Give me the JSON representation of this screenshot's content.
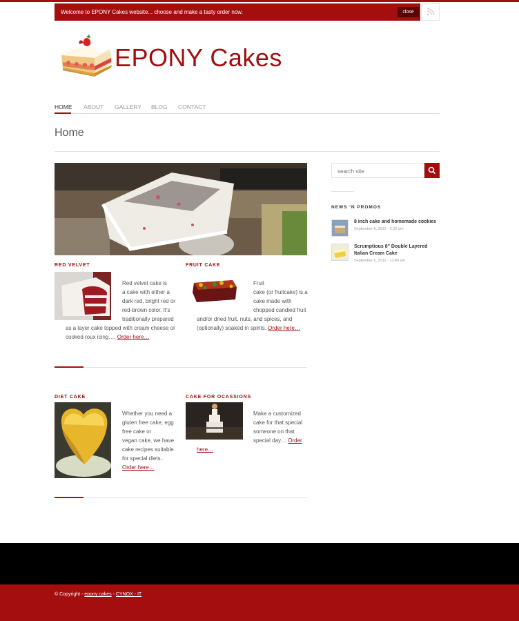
{
  "topbar": {
    "welcome": "Welcome to EPONY Cakes website... choose and make a tasty order now.",
    "close_label": "close"
  },
  "site": {
    "title": "EPONY Cakes"
  },
  "nav": {
    "items": [
      "HOME",
      "ABOUT",
      "GALLERY",
      "BLOG",
      "CONTACT"
    ],
    "active": "HOME"
  },
  "page": {
    "title": "Home"
  },
  "sections": {
    "red_velvet": {
      "title": "RED VELVET",
      "lines": [
        "Red velvet cake is",
        "a cake with either a",
        "dark red, bright red or",
        "red-brown color. It's",
        "traditionally prepared",
        "as a layer cake topped with cream cheese or"
      ],
      "last_line": "cooked roux icing….",
      "link": "Order here…"
    },
    "fruit_cake": {
      "title": "FRUIT CAKE",
      "lines": [
        "Fruit",
        "cake (or fruitcake) is a",
        "cake made with",
        "chopped candied fruit",
        "and/or dried fruit, nuts, and spices, and"
      ],
      "last_line": "(optionally) soaked in spirits.",
      "link": "Order here…"
    },
    "diet_cake": {
      "title": "DIET CAKE",
      "lines": [
        "Whether you need a",
        "gluten free cake, egg",
        "free cake or",
        "vegan cake, we have",
        "cake recipes suitable",
        "for special diets.."
      ],
      "link": "Order here…"
    },
    "occasions": {
      "title": "CAKE FOR OCASSIONS",
      "lines": [
        "Make a customized",
        "cake for that special",
        "someone on that"
      ],
      "last_line": "special day…",
      "link_a": "Order",
      "link_b": "here…"
    }
  },
  "sidebar": {
    "search_placeholder": "search site",
    "heading": "NEWS 'N PROMOS",
    "news": [
      {
        "title": "8 inch cake and homemade cookies",
        "date": "September 6, 2012 - 5:32 pm"
      },
      {
        "title_line1": "Scrumptious 8\" Double Layered",
        "title_line2": "Italian Cream Cake",
        "date": "September 6, 2012 - 11:49 am"
      }
    ]
  },
  "footer": {
    "prefix": "© Copyright -",
    "site_link": "epony cakes",
    "sep": "-",
    "company_link": "CYNOX - IT"
  },
  "colors": {
    "accent": "#a00f0f",
    "footer_red": "#a40e0e",
    "footer_black": "#000000"
  }
}
